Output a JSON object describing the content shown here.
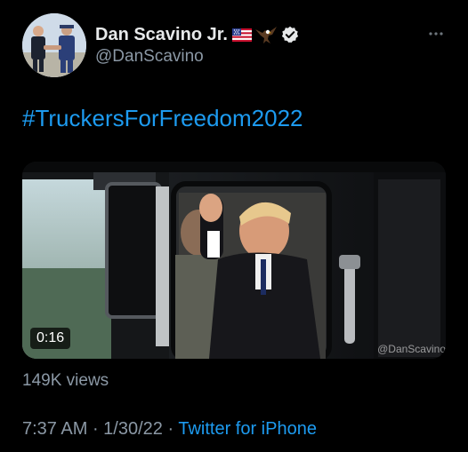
{
  "tweet": {
    "author": {
      "display_name": "Dan Scavino Jr.",
      "handle": "@DanScavino",
      "badges": [
        "us-flag-emoji",
        "eagle-emoji",
        "verified-badge"
      ]
    },
    "more_icon": "ellipsis-icon",
    "text": "#TruckersForFreedom2022",
    "video": {
      "duration": "0:16",
      "watermark": "@DanScavino"
    },
    "views": "149K views",
    "time": "7:37 AM",
    "separator1": " · ",
    "date": "1/30/22",
    "separator2": " · ",
    "source": "Twitter for iPhone"
  },
  "colors": {
    "background": "#000000",
    "primary_text": "#e7e9ea",
    "secondary_text": "#8b98a5",
    "link": "#1d9bf0"
  }
}
